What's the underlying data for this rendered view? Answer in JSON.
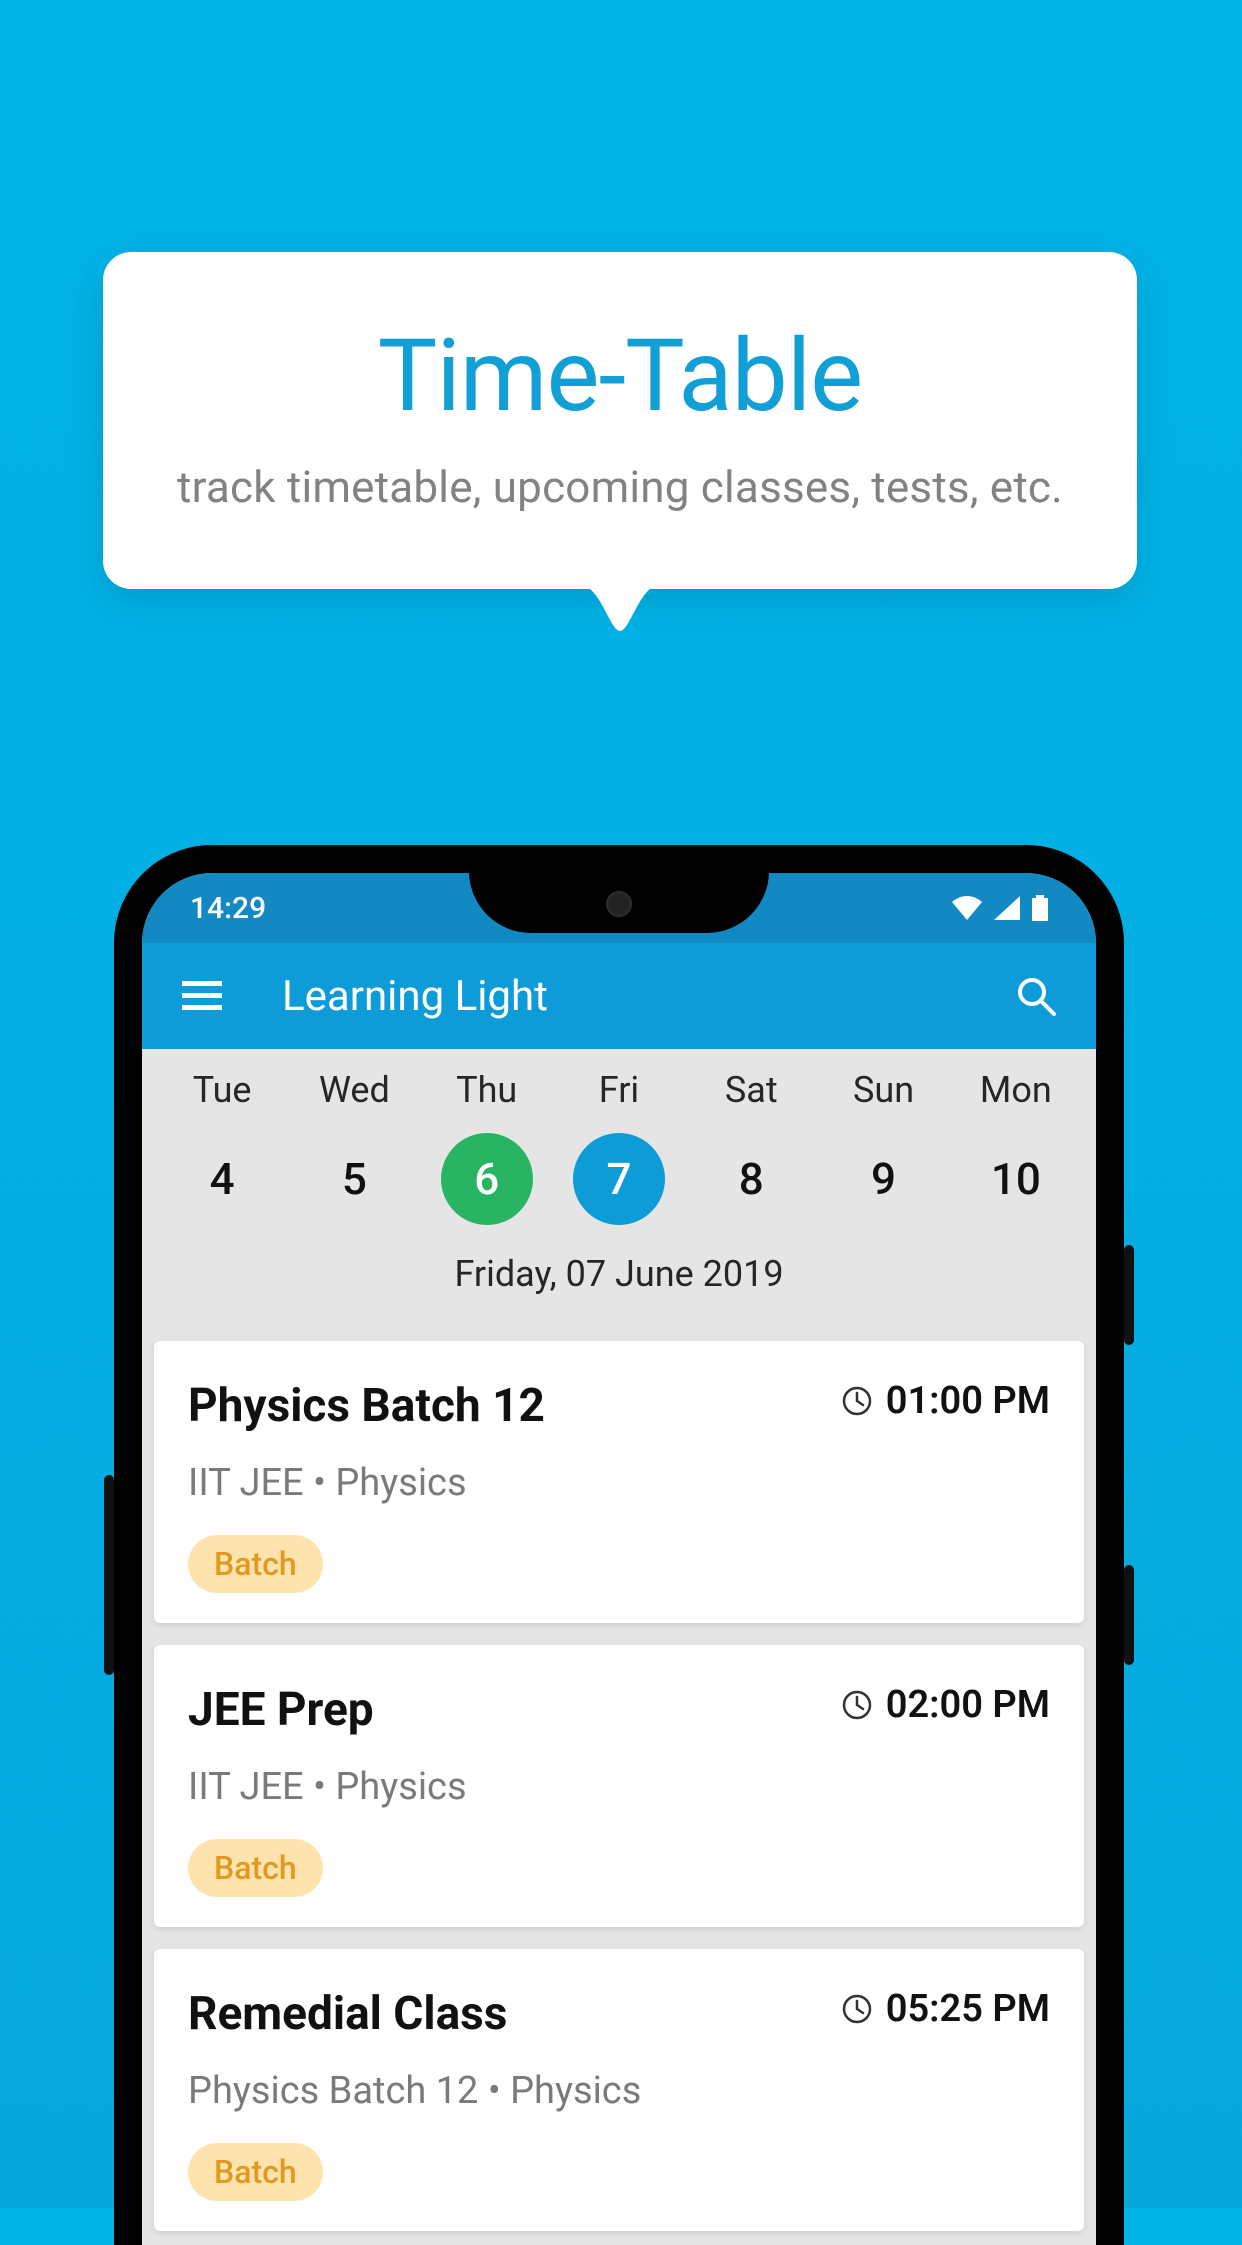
{
  "callout": {
    "title": "Time-Table",
    "subtitle": "track timetable, upcoming classes, tests, etc."
  },
  "status": {
    "time": "14:29"
  },
  "appbar": {
    "title": "Learning Light"
  },
  "date_strip": {
    "full_date": "Friday, 07 June 2019",
    "days": [
      {
        "dow": "Tue",
        "dom": "4",
        "today": false,
        "selected": false
      },
      {
        "dow": "Wed",
        "dom": "5",
        "today": false,
        "selected": false
      },
      {
        "dow": "Thu",
        "dom": "6",
        "today": true,
        "selected": false
      },
      {
        "dow": "Fri",
        "dom": "7",
        "today": false,
        "selected": true
      },
      {
        "dow": "Sat",
        "dom": "8",
        "today": false,
        "selected": false
      },
      {
        "dow": "Sun",
        "dom": "9",
        "today": false,
        "selected": false
      },
      {
        "dow": "Mon",
        "dom": "10",
        "today": false,
        "selected": false
      }
    ]
  },
  "classes": [
    {
      "title": "Physics Batch 12",
      "subject": "IIT JEE • Physics",
      "time": "01:00 PM",
      "badge": "Batch"
    },
    {
      "title": "JEE Prep",
      "subject": "IIT JEE • Physics",
      "time": "02:00 PM",
      "badge": "Batch"
    },
    {
      "title": "Remedial Class",
      "subject": "Physics Batch 12 • Physics",
      "time": "05:25 PM",
      "badge": "Batch"
    }
  ]
}
